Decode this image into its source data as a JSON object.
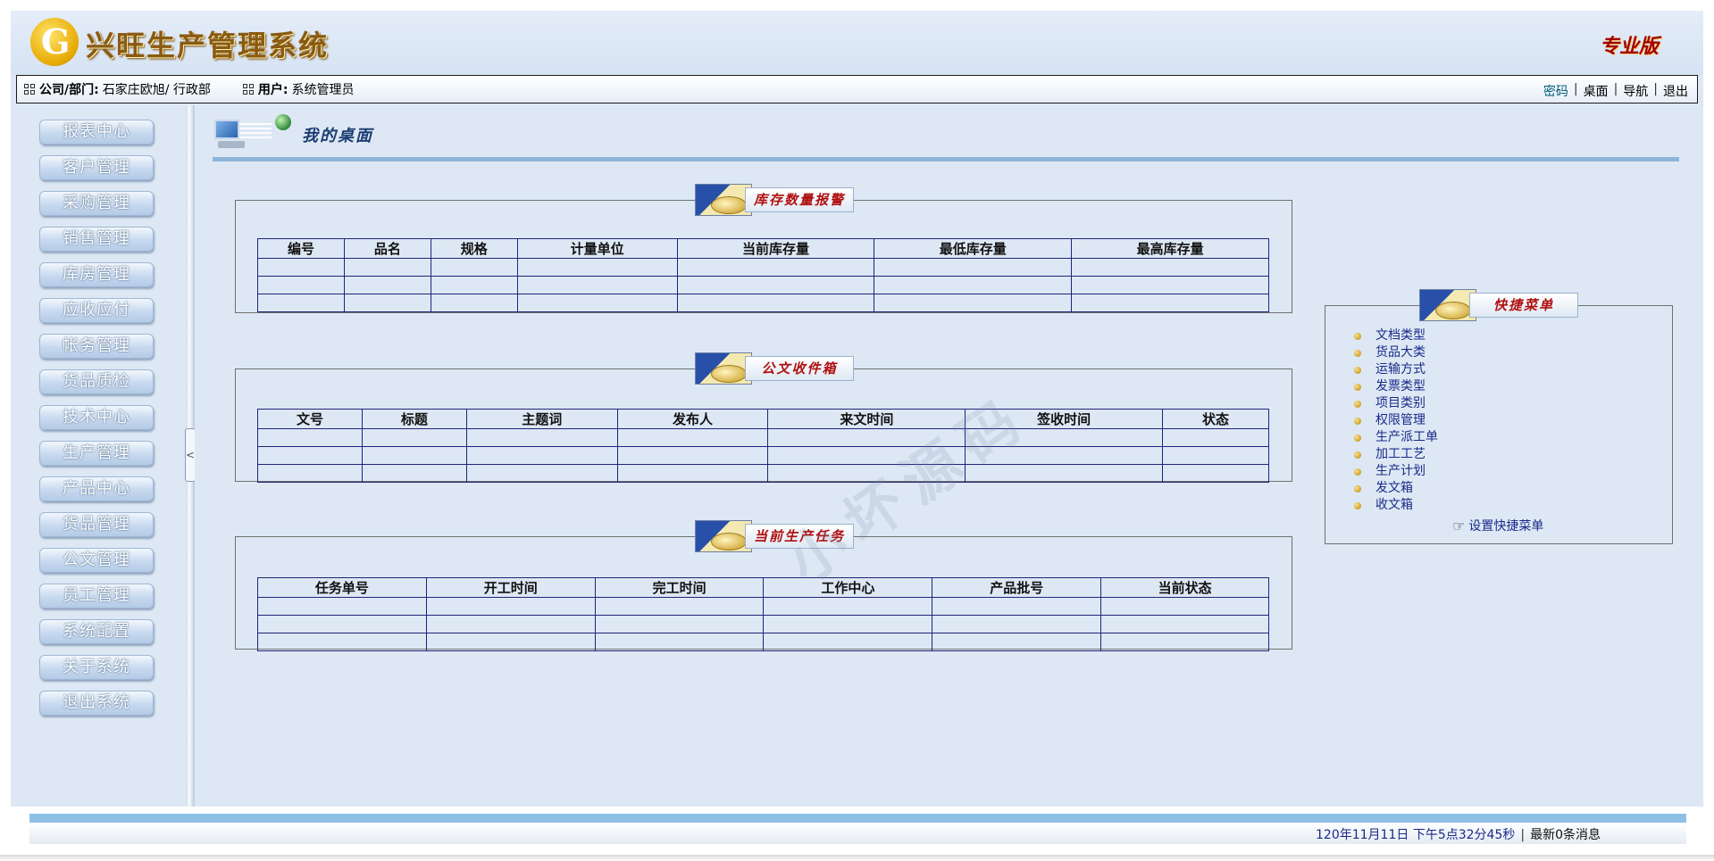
{
  "header": {
    "logo_char": "G",
    "title": "兴旺生产管理系统",
    "edition": "专业版"
  },
  "infobar": {
    "company_label": "公司/部门:",
    "company_value": "石家庄欧旭/ 行政部",
    "user_label": "用户:",
    "user_value": "系统管理员",
    "links": [
      "密码",
      "桌面",
      "导航",
      "退出"
    ]
  },
  "sidebar": {
    "items": [
      "报表中心",
      "客户管理",
      "采购管理",
      "销售管理",
      "库房管理",
      "应收应付",
      "帐务管理",
      "货品质检",
      "技术中心",
      "生产管理",
      "产品中心",
      "货品管理",
      "公文管理",
      "员工管理",
      "系统配置",
      "关于系统",
      "退出系统"
    ]
  },
  "splitter": {
    "handle_glyph": "<"
  },
  "desk": {
    "title": "我的桌面"
  },
  "inventory": {
    "title": "库存数量报警",
    "columns": [
      "编号",
      "品名",
      "规格",
      "计量单位",
      "当前库存量",
      "最低库存量",
      "最高库存量"
    ]
  },
  "inbox": {
    "title": "公文收件箱",
    "columns": [
      "文号",
      "标题",
      "主题词",
      "发布人",
      "来文时间",
      "签收时间",
      "状态"
    ]
  },
  "tasks": {
    "title": "当前生产任务",
    "columns": [
      "任务单号",
      "开工时间",
      "完工时间",
      "工作中心",
      "产品批号",
      "当前状态"
    ]
  },
  "quick_menu": {
    "title": "快捷菜单",
    "items": [
      "文档类型",
      "货品大类",
      "运输方式",
      "发票类型",
      "项目类别",
      "权限管理",
      "生产派工单",
      "加工工艺",
      "生产计划",
      "发文箱",
      "收文箱"
    ],
    "settings_label": "设置快捷菜单",
    "settings_glyph": "☞"
  },
  "watermark": "小坏源码",
  "footer": {
    "datetime": "120年11月11日 下午5点32分45秒",
    "messages": "最新0条消息"
  },
  "colors": {
    "background": "#dde8f4",
    "accent": "#8eb5da",
    "table_border": "#23237a",
    "link": "#1a2a8a"
  }
}
